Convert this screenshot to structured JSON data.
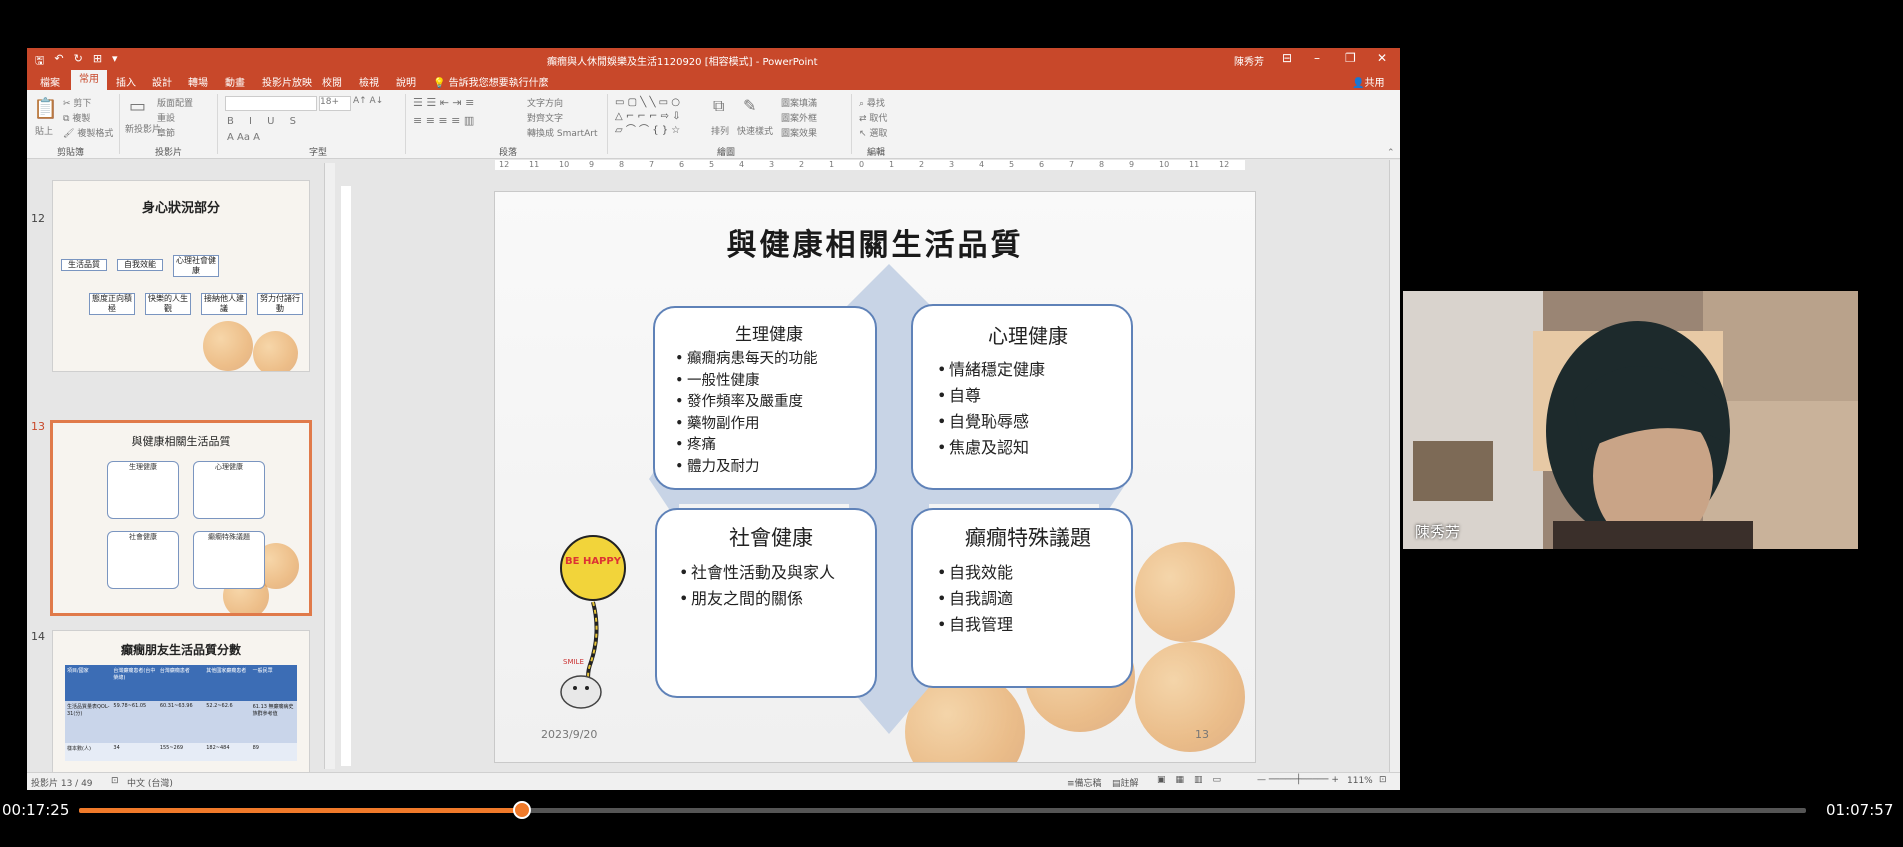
{
  "window": {
    "title": "癲癇與人休閒娛樂及生活1120920 [相容模式] - PowerPoint",
    "user": "陳秀芳",
    "minimize": "–",
    "restore": "❐",
    "close": "✕"
  },
  "tabs": [
    "檔案",
    "常用",
    "插入",
    "設計",
    "轉場",
    "動畫",
    "投影片放映",
    "校閱",
    "檢視",
    "說明"
  ],
  "active_tab": "常用",
  "tell_me": "告訴我您想要執行什麼",
  "share": "共用",
  "ribbon_groups": [
    "剪貼簿",
    "投影片",
    "字型",
    "段落",
    "繪圖",
    "編輯"
  ],
  "ribbon_buttons": {
    "paste": "貼上",
    "cut": "剪下",
    "copy": "複製",
    "format_painter": "複製格式",
    "new_slide": "新投影片",
    "layout": "版面配置",
    "reset": "重設",
    "section": "章節",
    "font_size": "18+",
    "text_direction": "文字方向",
    "align_text": "對齊文字",
    "smartart": "轉換成 SmartArt",
    "arrange": "排列",
    "quick_styles": "快速樣式",
    "shape_fill": "圖案填滿",
    "shape_outline": "圖案外框",
    "shape_effects": "圖案效果",
    "find": "尋找",
    "replace": "取代",
    "select": "選取"
  },
  "thumbnails": [
    {
      "num": "12",
      "title": "身心狀況部分",
      "boxes_top": [
        "生活品質",
        "自我效能",
        "心理社會健康"
      ],
      "boxes_bottom": [
        "態度正向積極",
        "快樂的人生觀",
        "接納他人建議",
        "努力付諸行動"
      ]
    },
    {
      "num": "13",
      "title": "與健康相關生活品質",
      "quads": [
        "生理健康",
        "心理健康",
        "社會健康",
        "癲癇特殊議題"
      ]
    },
    {
      "num": "14",
      "title": "癲癇朋友生活品質分數",
      "headers": [
        "項目/國家",
        "台灣癲癇患者(台中榮總)",
        "台灣癲癇患者",
        "其他國家癲癇患者",
        "一般民眾"
      ],
      "row1": [
        "生活品質量表QOL-31(分)",
        "59.78~61.05",
        "60.31~63.96",
        "52.2~62.6",
        "61.13 無癲癇病史族群參考值"
      ],
      "row2": [
        "樣本數(人)",
        "34",
        "155~269",
        "182~484",
        "89"
      ]
    }
  ],
  "slide": {
    "title": "與健康相關生活品質",
    "date": "2023/9/20",
    "number": "13",
    "quadrants": [
      {
        "title": "生理健康",
        "items": [
          "癲癇病患每天的功能",
          "一般性健康",
          "發作頻率及嚴重度",
          "藥物副作用",
          "疼痛",
          "體力及耐力"
        ]
      },
      {
        "title": "心理健康",
        "items": [
          "情緒穩定健康",
          "自尊",
          "自覺恥辱感",
          "焦慮及認知"
        ]
      },
      {
        "title": "社會健康",
        "items": [
          "社會性活動及與家人",
          "朋友之間的關係"
        ]
      },
      {
        "title": "癲癇特殊議題",
        "items": [
          "自我效能",
          "自我調適",
          "自我管理"
        ]
      }
    ],
    "balloon_text": "BE HAPPY",
    "smile_text": "SMILE"
  },
  "status": {
    "slide_counter": "投影片 13 / 49",
    "language": "中文 (台灣)",
    "notes": "備忘稿",
    "comments": "註解",
    "zoom": "111%"
  },
  "webcam": {
    "name": "陳秀芳"
  },
  "player": {
    "current": "00:17:25",
    "total": "01:07:57",
    "progress": 0.2564
  },
  "colors": {
    "ppt_accent": "#c8482a",
    "progress": "#f07a2a",
    "quad_border": "#5f82b8"
  }
}
